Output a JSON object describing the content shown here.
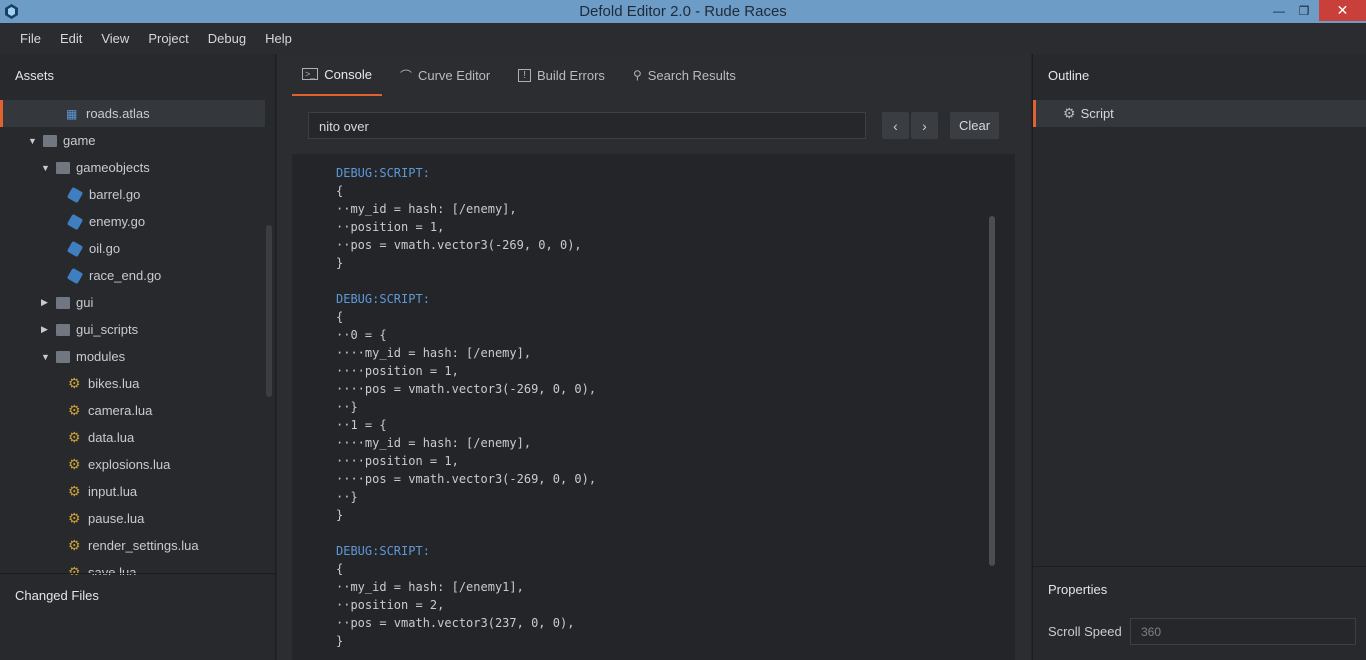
{
  "window": {
    "title": "Defold Editor 2.0 - Rude Races",
    "minimize": "—",
    "maximize": "❐",
    "close": "✕"
  },
  "menu": [
    "File",
    "Edit",
    "View",
    "Project",
    "Debug",
    "Help"
  ],
  "assets": {
    "header": "Assets",
    "items": [
      {
        "label": "roads.atlas",
        "icon": "atlas-icon"
      },
      {
        "label": "game",
        "icon": "folder-icon"
      },
      {
        "label": "gameobjects",
        "icon": "folder-icon"
      },
      {
        "label": "barrel.go",
        "icon": "gameobject-icon"
      },
      {
        "label": "enemy.go",
        "icon": "gameobject-icon"
      },
      {
        "label": "oil.go",
        "icon": "gameobject-icon"
      },
      {
        "label": "race_end.go",
        "icon": "gameobject-icon"
      },
      {
        "label": "gui",
        "icon": "folder-icon"
      },
      {
        "label": "gui_scripts",
        "icon": "folder-icon"
      },
      {
        "label": "modules",
        "icon": "folder-icon"
      },
      {
        "label": "bikes.lua",
        "icon": "script-gear-icon"
      },
      {
        "label": "camera.lua",
        "icon": "script-gear-icon"
      },
      {
        "label": "data.lua",
        "icon": "script-gear-icon"
      },
      {
        "label": "explosions.lua",
        "icon": "script-gear-icon"
      },
      {
        "label": "input.lua",
        "icon": "script-gear-icon"
      },
      {
        "label": "pause.lua",
        "icon": "script-gear-icon"
      },
      {
        "label": "render_settings.lua",
        "icon": "script-gear-icon"
      },
      {
        "label": "save.lua",
        "icon": "script-gear-icon"
      }
    ]
  },
  "changed_files": {
    "header": "Changed Files"
  },
  "tabs": [
    {
      "label": "Console",
      "icon": "terminal-icon"
    },
    {
      "label": "Curve Editor",
      "icon": "curve-icon"
    },
    {
      "label": "Build Errors",
      "icon": "error-icon"
    },
    {
      "label": "Search Results",
      "icon": "search-icon"
    }
  ],
  "console": {
    "search_value": "nito over",
    "prev": "‹",
    "next": "›",
    "clear_label": "Clear",
    "lines": [
      "DEBUG:SCRIPT:",
      "{",
      "··my_id = hash: [/enemy],",
      "··position = 1,",
      "··pos = vmath.vector3(-269, 0, 0),",
      "}",
      "",
      "DEBUG:SCRIPT:",
      "{",
      "··0 = {",
      "····my_id = hash: [/enemy],",
      "····position = 1,",
      "····pos = vmath.vector3(-269, 0, 0),",
      "··}",
      "··1 = {",
      "····my_id = hash: [/enemy],",
      "····position = 1,",
      "····pos = vmath.vector3(-269, 0, 0),",
      "··}",
      "}",
      "",
      "DEBUG:SCRIPT:",
      "{",
      "··my_id = hash: [/enemy1],",
      "··position = 2,",
      "··pos = vmath.vector3(237, 0, 0),",
      "}"
    ]
  },
  "outline": {
    "header": "Outline",
    "item": "Script"
  },
  "properties": {
    "header": "Properties",
    "scroll_speed_label": "Scroll Speed",
    "scroll_speed_placeholder": "360"
  }
}
